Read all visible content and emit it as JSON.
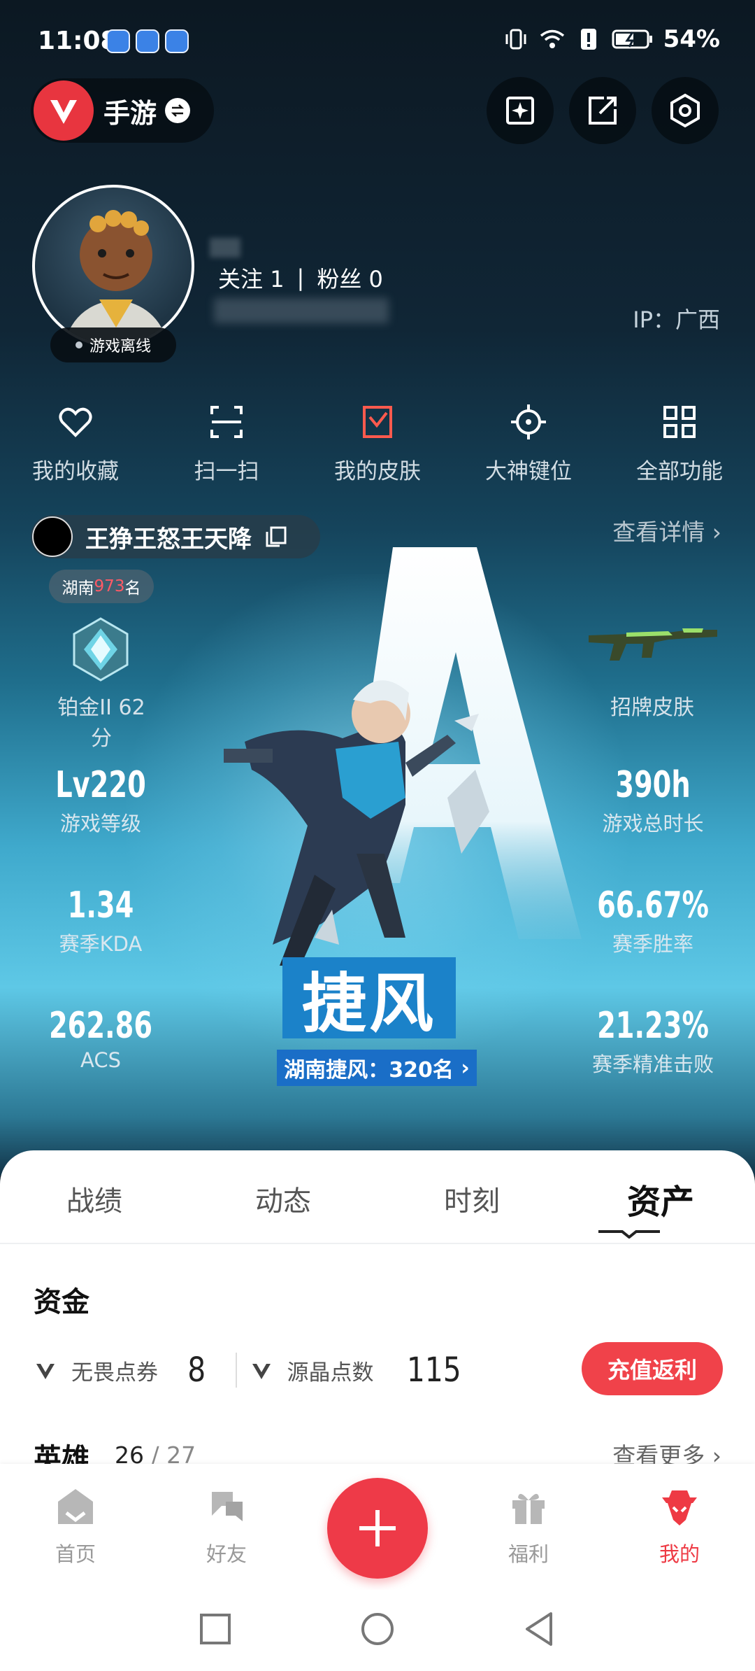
{
  "status_bar": {
    "time": "11:08",
    "battery": "54%"
  },
  "top_bar": {
    "game_name": "手游",
    "brand_color": "#e8353f"
  },
  "profile": {
    "online_status": "游戏离线",
    "follow_label": "关注",
    "follow_count": "1",
    "separator": "|",
    "fans_label": "粉丝",
    "fans_count": "0",
    "ip": "IP：广西"
  },
  "quick_actions": [
    {
      "label": "我的收藏",
      "icon": "heart-icon"
    },
    {
      "label": "扫一扫",
      "icon": "scan-icon"
    },
    {
      "label": "我的皮肤",
      "icon": "skin-icon"
    },
    {
      "label": "大神键位",
      "icon": "crosshair-icon"
    },
    {
      "label": "全部功能",
      "icon": "grid-icon"
    }
  ],
  "rank_card": {
    "team_name": "王狰王怒王天降",
    "detail_link": "查看详情",
    "region_prefix": "湖南",
    "region_rank": "973",
    "region_suffix": "名",
    "rank_label": "铂金II 62分",
    "skin_label": "招牌皮肤",
    "hero_name": "捷风",
    "hero_rank": "湖南捷风：320名",
    "stats": {
      "level_value": "Lv220",
      "level_label": "游戏等级",
      "hours_value": "390h",
      "hours_label": "游戏总时长",
      "kda_value": "1.34",
      "kda_label": "赛季KDA",
      "winrate_value": "66.67%",
      "winrate_label": "赛季胜率",
      "acs_value": "262.86",
      "acs_label": "ACS",
      "accuracy_value": "21.23%",
      "accuracy_label": "赛季精准击败"
    }
  },
  "tabs": [
    "战绩",
    "动态",
    "时刻",
    "资产"
  ],
  "active_tab": "资产",
  "assets": {
    "funds_title": "资金",
    "vp_label": "无畏点券",
    "vp_value": "8",
    "rp_label": "源晶点数",
    "rp_value": "115",
    "recharge_button": "充值返利",
    "heroes_title": "英雄",
    "heroes_owned": "26",
    "heroes_sep": "/",
    "heroes_total": "27",
    "more_link": "查看更多"
  },
  "bottom_nav": [
    {
      "label": "首页",
      "icon": "home-icon"
    },
    {
      "label": "好友",
      "icon": "friends-icon"
    },
    {
      "label": "福利",
      "icon": "gift-icon"
    },
    {
      "label": "我的",
      "icon": "me-icon"
    }
  ],
  "accent_color": "#ee3a48"
}
